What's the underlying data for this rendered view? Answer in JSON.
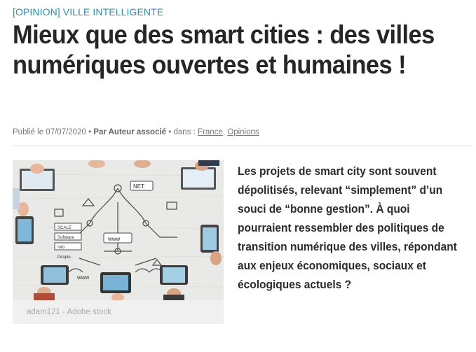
{
  "article": {
    "category": "[OPINION] VILLE INTELLIGENTE",
    "title": "Mieux que des smart cities : des villes numériques ouvertes et humaines !",
    "meta": {
      "published_prefix": "Publié le 07/07/2020",
      "separator": "•",
      "author": "Par Auteur associé",
      "in_label": "dans :",
      "tags": [
        "France",
        "Opinions"
      ]
    },
    "image": {
      "caption": "adam121 - Adobe stock",
      "labels": [
        "NET",
        "www",
        "SCALE",
        "Software",
        "Info",
        "People",
        "www"
      ]
    },
    "summary": "Les projets de smart city sont souvent dépolitisés, relevant “simplement” d’un souci de “bonne gestion”. À quoi pourraient ressembler des politiques de transition numérique des villes, répondant aux enjeux économiques, sociaux et écologiques actuels ?"
  }
}
